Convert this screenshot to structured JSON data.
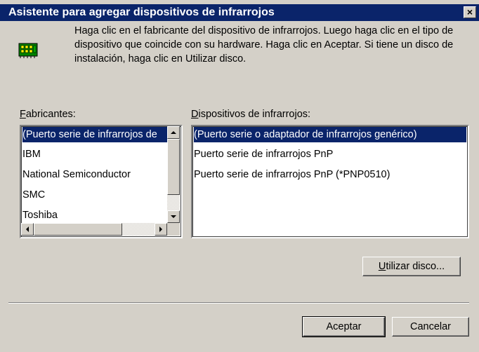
{
  "dialog": {
    "title": "Asistente para agregar dispositivos de infrarrojos",
    "close_label": "×",
    "instructions": "Haga clic en el fabricante del dispositivo de infrarrojos. Luego haga clic en el tipo de dispositivo que coincide con su hardware. Haga clic en Aceptar. Si tiene un disco de instalación, haga clic en Utilizar disco.",
    "icon": "infrared-device-icon"
  },
  "manufacturers": {
    "label_mnemonic": "F",
    "label_rest": "abricantes:",
    "items": [
      "(Puerto serie de infrarrojos de",
      "IBM",
      "National Semiconductor",
      "SMC",
      "Toshiba"
    ],
    "selected_index": 0
  },
  "devices": {
    "label_mnemonic": "D",
    "label_rest": "ispositivos de infrarrojos:",
    "items": [
      "(Puerto serie o adaptador de infrarrojos genérico)",
      "Puerto serie de infrarrojos PnP",
      "Puerto serie de infrarrojos PnP (*PNP0510)"
    ],
    "selected_index": 0
  },
  "buttons": {
    "have_disk_mnemonic": "U",
    "have_disk_rest": "tilizar disco...",
    "ok": "Aceptar",
    "cancel": "Cancelar"
  },
  "colors": {
    "title_bar": "#0a246a",
    "face": "#d4d0c8",
    "selection": "#0a246a"
  }
}
